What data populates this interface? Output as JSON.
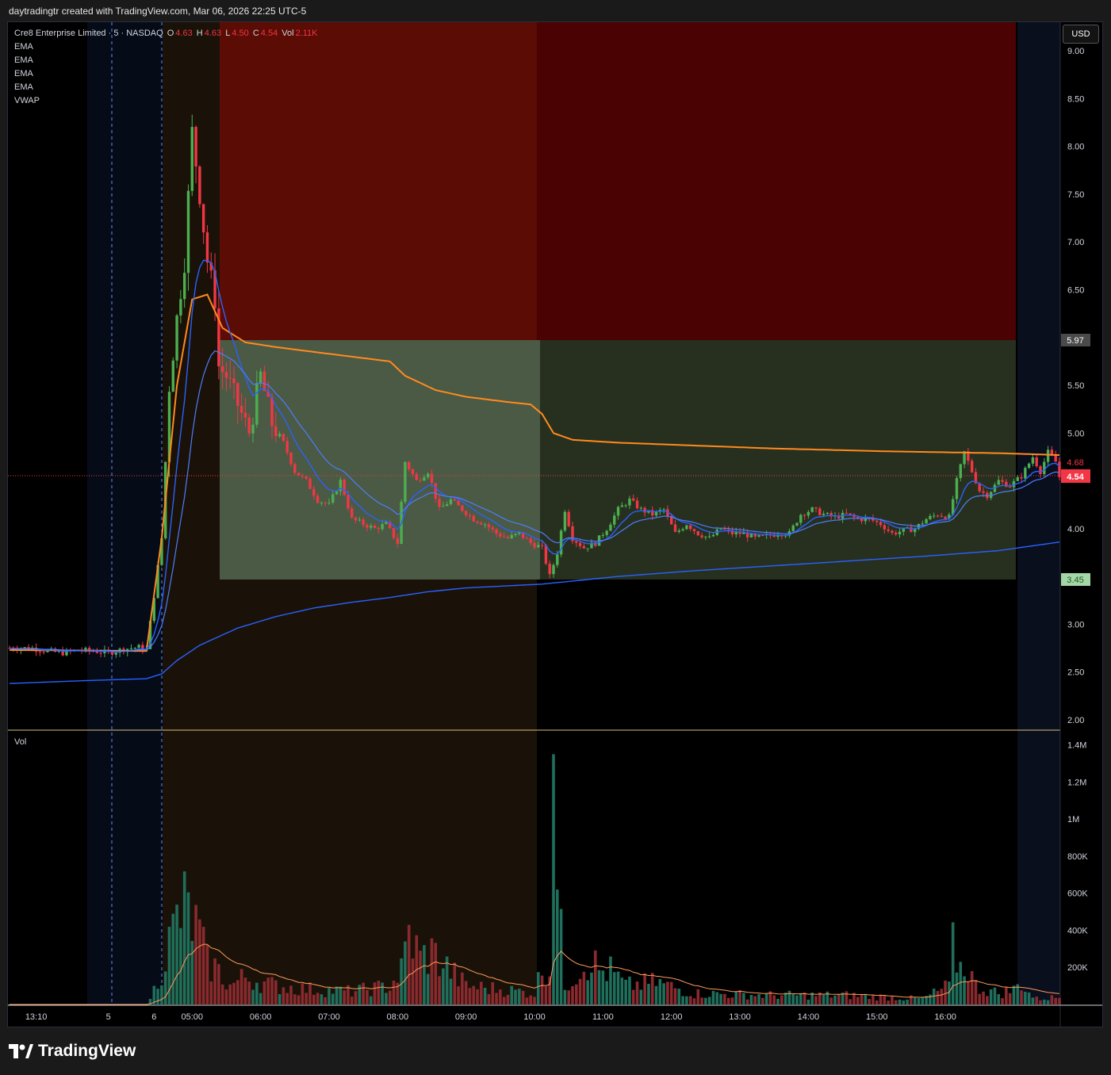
{
  "credit": "daytradingtr created with TradingView.com, Mar 06, 2026 22:25 UTC-5",
  "legend": {
    "symbol": "Cre8 Enterprise Limited · 5 · NASDAQ",
    "o_label": "O",
    "o": "4.63",
    "h_label": "H",
    "h": "4.63",
    "l_label": "L",
    "l": "4.50",
    "c_label": "C",
    "c": "4.54",
    "vol_label": "Vol",
    "vol": "2.11K",
    "indicators": [
      "EMA",
      "EMA",
      "EMA",
      "EMA",
      "VWAP"
    ]
  },
  "currency": "USD",
  "volume_pane_title": "Vol",
  "brand": "TradingView",
  "price_labels": {
    "target": "5.97",
    "stop_alt": "4.68",
    "last": "4.54",
    "entry": "3.45"
  },
  "colors": {
    "up": "#26a69a",
    "down": "#ef5350",
    "ema_fast": "#2962ff",
    "vwap": "#ff8a1f",
    "stop_zone": "#5a0c05",
    "target_zone": "#4b5a44",
    "premarket": "#1a1208",
    "afterhours": "#0a0f1e"
  },
  "chart_data": {
    "type": "candlestick",
    "x_ticks": [
      "13:10",
      "5",
      "6",
      "05:00",
      "06:00",
      "07:00",
      "08:00",
      "09:00",
      "10:00",
      "11:00",
      "12:00",
      "13:00",
      "14:00",
      "15:00",
      "16:00"
    ],
    "y_ticks": [
      "9.00",
      "8.50",
      "8.00",
      "7.50",
      "7.00",
      "6.50",
      "5.50",
      "5.00",
      "4.00",
      "3.00",
      "2.50",
      "2.00"
    ],
    "volume_ticks": [
      "1.4M",
      "1.2M",
      "1M",
      "800K",
      "600K",
      "400K",
      "200K"
    ],
    "ylim": [
      1.9,
      9.3
    ],
    "volume_ylim": [
      0,
      1.42
    ],
    "position": {
      "entry": 3.45,
      "target": 5.97,
      "stop": 9.3
    },
    "last_price": 4.54,
    "close_path": [
      [
        0,
        2.75
      ],
      [
        6,
        2.75
      ],
      [
        10,
        2.72
      ],
      [
        14,
        2.7
      ],
      [
        18,
        2.73
      ],
      [
        22,
        2.72
      ],
      [
        26,
        2.7
      ],
      [
        30,
        2.74
      ],
      [
        34,
        2.76
      ],
      [
        36,
        2.73
      ],
      [
        38,
        3.3
      ],
      [
        40,
        3.9
      ],
      [
        42,
        5.5
      ],
      [
        44,
        6.2
      ],
      [
        46,
        6.8
      ],
      [
        48,
        8.15
      ],
      [
        50,
        7.5
      ],
      [
        52,
        6.8
      ],
      [
        53,
        6.6
      ],
      [
        54,
        6.4
      ],
      [
        55,
        5.7
      ],
      [
        57,
        5.6
      ],
      [
        60,
        5.3
      ],
      [
        63,
        5.0
      ],
      [
        66,
        5.6
      ],
      [
        69,
        5.1
      ],
      [
        72,
        4.9
      ],
      [
        75,
        4.6
      ],
      [
        78,
        4.5
      ],
      [
        81,
        4.3
      ],
      [
        84,
        4.25
      ],
      [
        87,
        4.5
      ],
      [
        90,
        4.1
      ],
      [
        93,
        4.05
      ],
      [
        96,
        4.0
      ],
      [
        99,
        4.05
      ],
      [
        102,
        3.85
      ],
      [
        104,
        4.7
      ],
      [
        107,
        4.5
      ],
      [
        110,
        4.6
      ],
      [
        113,
        4.2
      ],
      [
        116,
        4.3
      ],
      [
        119,
        4.2
      ],
      [
        122,
        4.1
      ],
      [
        125,
        4.05
      ],
      [
        128,
        3.95
      ],
      [
        131,
        3.9
      ],
      [
        134,
        3.95
      ],
      [
        137,
        3.85
      ],
      [
        140,
        3.8
      ],
      [
        142,
        3.5
      ],
      [
        144,
        3.75
      ],
      [
        146,
        4.2
      ],
      [
        148,
        3.9
      ],
      [
        151,
        3.8
      ],
      [
        154,
        3.85
      ],
      [
        157,
        4.0
      ],
      [
        160,
        4.2
      ],
      [
        163,
        4.3
      ],
      [
        166,
        4.2
      ],
      [
        169,
        4.15
      ],
      [
        172,
        4.2
      ],
      [
        175,
        3.95
      ],
      [
        178,
        4.05
      ],
      [
        181,
        3.95
      ],
      [
        184,
        3.9
      ],
      [
        187,
        4.0
      ],
      [
        190,
        3.95
      ],
      [
        193,
        3.95
      ],
      [
        196,
        3.9
      ],
      [
        199,
        3.92
      ],
      [
        202,
        3.95
      ],
      [
        205,
        3.95
      ],
      [
        208,
        4.15
      ],
      [
        211,
        4.2
      ],
      [
        214,
        4.15
      ],
      [
        217,
        4.12
      ],
      [
        220,
        4.15
      ],
      [
        223,
        4.1
      ],
      [
        226,
        4.1
      ],
      [
        229,
        4.05
      ],
      [
        232,
        3.95
      ],
      [
        235,
        3.98
      ],
      [
        238,
        4.0
      ],
      [
        241,
        4.1
      ],
      [
        244,
        4.15
      ],
      [
        247,
        4.12
      ],
      [
        249,
        4.5
      ],
      [
        251,
        4.8
      ],
      [
        253,
        4.6
      ],
      [
        255,
        4.4
      ],
      [
        257,
        4.35
      ],
      [
        260,
        4.5
      ],
      [
        263,
        4.45
      ],
      [
        266,
        4.55
      ],
      [
        269,
        4.75
      ],
      [
        271,
        4.6
      ],
      [
        273,
        4.8
      ],
      [
        275,
        4.7
      ],
      [
        276,
        4.54
      ]
    ],
    "volume_path": [
      [
        0,
        0.0
      ],
      [
        36,
        0.0
      ],
      [
        38,
        0.08
      ],
      [
        40,
        0.2
      ],
      [
        42,
        0.33
      ],
      [
        44,
        0.45
      ],
      [
        46,
        0.52
      ],
      [
        48,
        0.45
      ],
      [
        50,
        0.37
      ],
      [
        52,
        0.22
      ],
      [
        54,
        0.2
      ],
      [
        58,
        0.1
      ],
      [
        62,
        0.15
      ],
      [
        66,
        0.12
      ],
      [
        70,
        0.1
      ],
      [
        80,
        0.08
      ],
      [
        90,
        0.07
      ],
      [
        100,
        0.1
      ],
      [
        103,
        0.18
      ],
      [
        105,
        0.38
      ],
      [
        108,
        0.25
      ],
      [
        111,
        0.28
      ],
      [
        115,
        0.2
      ],
      [
        120,
        0.1
      ],
      [
        130,
        0.08
      ],
      [
        138,
        0.06
      ],
      [
        140,
        0.2
      ],
      [
        142,
        0.18
      ],
      [
        143,
        1.35
      ],
      [
        144,
        0.6
      ],
      [
        146,
        0.1
      ],
      [
        150,
        0.2
      ],
      [
        153,
        0.25
      ],
      [
        155,
        0.18
      ],
      [
        158,
        0.18
      ],
      [
        162,
        0.1
      ],
      [
        170,
        0.12
      ],
      [
        180,
        0.06
      ],
      [
        200,
        0.05
      ],
      [
        220,
        0.05
      ],
      [
        240,
        0.03
      ],
      [
        247,
        0.1
      ],
      [
        248,
        0.3
      ],
      [
        250,
        0.2
      ],
      [
        252,
        0.2
      ],
      [
        254,
        0.1
      ],
      [
        260,
        0.06
      ],
      [
        264,
        0.08
      ],
      [
        266,
        0.12
      ],
      [
        268,
        0.06
      ],
      [
        270,
        0.03
      ],
      [
        276,
        0.04
      ]
    ],
    "vwap_path": [
      [
        0,
        2.73
      ],
      [
        36,
        2.72
      ],
      [
        40,
        3.9
      ],
      [
        44,
        5.5
      ],
      [
        48,
        6.4
      ],
      [
        52,
        6.45
      ],
      [
        56,
        6.1
      ],
      [
        62,
        5.95
      ],
      [
        70,
        5.9
      ],
      [
        80,
        5.85
      ],
      [
        90,
        5.8
      ],
      [
        100,
        5.75
      ],
      [
        104,
        5.6
      ],
      [
        112,
        5.45
      ],
      [
        120,
        5.38
      ],
      [
        130,
        5.33
      ],
      [
        137,
        5.3
      ],
      [
        140,
        5.2
      ],
      [
        143,
        5.0
      ],
      [
        148,
        4.93
      ],
      [
        160,
        4.9
      ],
      [
        180,
        4.87
      ],
      [
        200,
        4.84
      ],
      [
        230,
        4.81
      ],
      [
        260,
        4.79
      ],
      [
        276,
        4.77
      ]
    ],
    "ema_slow_path": [
      [
        0,
        2.38
      ],
      [
        20,
        2.41
      ],
      [
        36,
        2.43
      ],
      [
        40,
        2.48
      ],
      [
        44,
        2.62
      ],
      [
        50,
        2.78
      ],
      [
        60,
        2.96
      ],
      [
        70,
        3.08
      ],
      [
        80,
        3.17
      ],
      [
        90,
        3.23
      ],
      [
        100,
        3.28
      ],
      [
        110,
        3.34
      ],
      [
        120,
        3.38
      ],
      [
        140,
        3.42
      ],
      [
        160,
        3.5
      ],
      [
        180,
        3.56
      ],
      [
        200,
        3.61
      ],
      [
        220,
        3.66
      ],
      [
        240,
        3.71
      ],
      [
        260,
        3.77
      ],
      [
        276,
        3.86
      ]
    ]
  }
}
